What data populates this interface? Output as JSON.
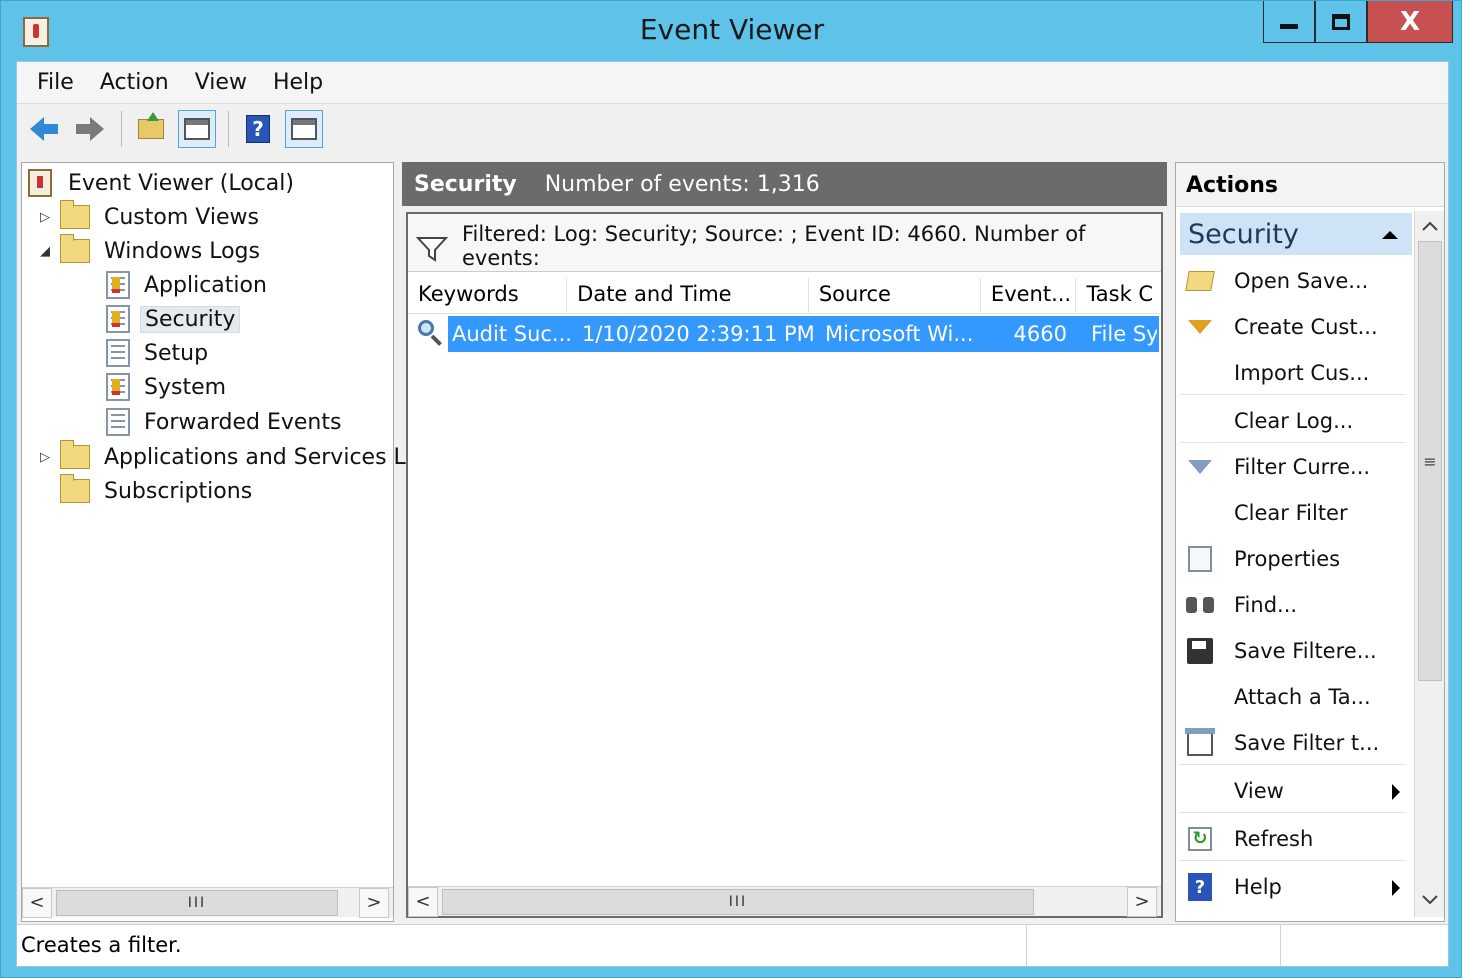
{
  "window": {
    "title": "Event Viewer",
    "min_label": "",
    "max_label": "",
    "close_label": "X"
  },
  "menu": [
    "File",
    "Action",
    "View",
    "Help"
  ],
  "toolbar": {
    "icons": [
      "back-arrow-icon",
      "forward-arrow-icon",
      "up-folder-icon",
      "show-hide-console-tree-icon",
      "help-icon",
      "show-hide-action-pane-icon"
    ]
  },
  "tree": {
    "root": "Event Viewer (Local)",
    "custom_views": "Custom Views",
    "windows_logs": "Windows Logs",
    "application": "Application",
    "security": "Security",
    "setup": "Setup",
    "system": "System",
    "forwarded": "Forwarded Events",
    "app_services": "Applications and Services Lo",
    "subscriptions": "Subscriptions",
    "expander_collapsed": "▷",
    "expander_expanded": "◢"
  },
  "center": {
    "log_name": "Security",
    "event_count_text": "Number of events: 1,316",
    "filter_text": "Filtered: Log: Security; Source: ; Event ID: 4660. Number of events:",
    "columns": [
      "Keywords",
      "Date and Time",
      "Source",
      "Event...",
      "Task C"
    ],
    "rows": [
      {
        "keywords": "Audit Suc...",
        "date_time": "1/10/2020 2:39:11 PM",
        "source": "Microsoft Wi...",
        "event_id": "4660",
        "task": "File Sy"
      }
    ],
    "scroll_left": "<",
    "scroll_right": ">",
    "scroll_thumb": "III"
  },
  "tree_scroll": {
    "left": "<",
    "right": ">",
    "thumb": "III"
  },
  "actions": {
    "header": "Actions",
    "section": "Security",
    "items": [
      {
        "label": "Open Save..."
      },
      {
        "label": "Create Cust..."
      },
      {
        "label": "Import Cus..."
      },
      {
        "label": "Clear Log..."
      },
      {
        "label": "Filter Curre..."
      },
      {
        "label": "Clear Filter"
      },
      {
        "label": "Properties"
      },
      {
        "label": "Find..."
      },
      {
        "label": "Save Filtere..."
      },
      {
        "label": "Attach a Ta..."
      },
      {
        "label": "Save Filter t..."
      },
      {
        "label": "View"
      },
      {
        "label": "Refresh"
      },
      {
        "label": "Help"
      }
    ],
    "scroll_up": "^",
    "scroll_down": "v",
    "scroll_grip": "≡"
  },
  "status": {
    "text": "Creates a filter."
  }
}
